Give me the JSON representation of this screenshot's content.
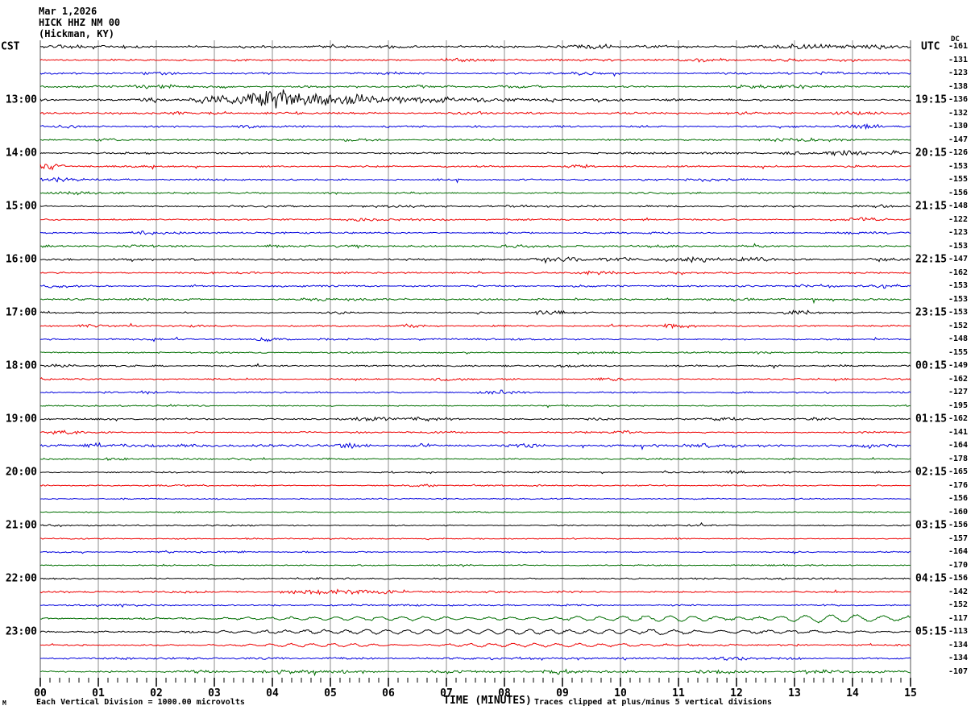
{
  "header": {
    "date": "Mar 1,2026",
    "station": "HICK HHZ NM 00",
    "location": "(Hickman, KY)"
  },
  "axes": {
    "left_label": "CST",
    "right_label": "UTC",
    "dc_header": "DC",
    "x_ticks": [
      "00",
      "01",
      "02",
      "03",
      "04",
      "05",
      "06",
      "07",
      "08",
      "09",
      "10",
      "11",
      "12",
      "13",
      "14",
      "15"
    ],
    "x_title": "TIME (MINUTES)"
  },
  "footer": {
    "scale_note": "Each Vertical Division = 1000.00 microvolts",
    "clip_note": "Traces clipped at plus/minus 5 vertical divisions",
    "corner_mark": "M"
  },
  "colors": {
    "trace_cycle": [
      "#000000",
      "#ee0000",
      "#0000dd",
      "#006e00"
    ],
    "grid": "#8c8c8c",
    "border": "#555555",
    "tick": "#000000"
  },
  "chart_data": {
    "type": "line",
    "kind": "seismogram-helicorder",
    "minutes_per_line": 15,
    "x_range_minutes": [
      0,
      15
    ],
    "note": "48 trace lines of 15 minutes each, colors cycle black/red/blue/green; cst = line start local time, utc = line end UTC time, dc = DC offset counts shown at right",
    "rows": [
      {
        "c": 0,
        "dc": -161,
        "amp": 1.2,
        "ev": [
          {
            "t": 0.6,
            "w": 0.5,
            "a": 2.2
          },
          {
            "t": 5.0,
            "w": 0.3,
            "a": 1.8
          },
          {
            "t": 9.6,
            "w": 0.4,
            "a": 2.6
          },
          {
            "t": 13.2,
            "w": 0.8,
            "a": 2.4
          },
          {
            "t": 14.6,
            "w": 0.3,
            "a": 2.2
          }
        ]
      },
      {
        "c": 1,
        "dc": -131,
        "amp": 1.0,
        "ev": [
          {
            "t": 7.2,
            "w": 0.3,
            "a": 1.8
          },
          {
            "t": 11.5,
            "w": 0.4,
            "a": 2.2
          },
          {
            "t": 12.8,
            "w": 0.3,
            "a": 2.0
          },
          {
            "t": 13.9,
            "w": 0.3,
            "a": 1.8
          }
        ]
      },
      {
        "c": 2,
        "dc": -123,
        "amp": 0.9,
        "ev": [
          {
            "t": 2.0,
            "w": 0.4,
            "a": 1.8
          },
          {
            "t": 6.0,
            "w": 0.3,
            "a": 1.5
          },
          {
            "t": 9.4,
            "w": 0.3,
            "a": 1.8
          },
          {
            "t": 13.6,
            "w": 0.4,
            "a": 1.6
          }
        ]
      },
      {
        "c": 3,
        "dc": -138,
        "amp": 1.0,
        "ev": [
          {
            "t": 2.1,
            "w": 0.5,
            "a": 2.2
          },
          {
            "t": 6.6,
            "w": 0.3,
            "a": 1.6
          },
          {
            "t": 12.9,
            "w": 1.0,
            "a": 1.8
          }
        ]
      },
      {
        "c": 0,
        "dc": -136,
        "cst": "13:00",
        "utc": "19:15",
        "amp": 1.1,
        "ev": [
          {
            "t": 2.0,
            "w": 0.25,
            "a": 3.0
          },
          {
            "t": 3.0,
            "w": 0.5,
            "a": 5.0
          },
          {
            "t": 4.0,
            "w": 0.55,
            "a": 13.0
          },
          {
            "t": 4.9,
            "w": 0.8,
            "a": 7.0
          },
          {
            "t": 6.2,
            "w": 1.2,
            "a": 3.5
          },
          {
            "t": 8.0,
            "w": 1.5,
            "a": 1.8
          }
        ]
      },
      {
        "c": 1,
        "dc": -132,
        "amp": 1.0,
        "ev": [
          {
            "t": 2.4,
            "w": 0.3,
            "a": 2.0
          },
          {
            "t": 7.6,
            "w": 0.3,
            "a": 1.6
          },
          {
            "t": 12.1,
            "w": 0.3,
            "a": 1.5
          },
          {
            "t": 14.1,
            "w": 0.4,
            "a": 2.2
          }
        ]
      },
      {
        "c": 2,
        "dc": -130,
        "amp": 0.9,
        "ev": [
          {
            "t": 0.5,
            "w": 0.3,
            "a": 1.8
          },
          {
            "t": 3.6,
            "w": 0.2,
            "a": 1.5
          },
          {
            "t": 14.2,
            "w": 0.4,
            "a": 2.4
          }
        ]
      },
      {
        "c": 3,
        "dc": -147,
        "amp": 0.9,
        "ev": [
          {
            "t": 1.1,
            "w": 0.3,
            "a": 1.6
          },
          {
            "t": 5.5,
            "w": 0.3,
            "a": 1.5
          },
          {
            "t": 13.1,
            "w": 0.6,
            "a": 2.0
          }
        ]
      },
      {
        "c": 0,
        "dc": -126,
        "cst": "14:00",
        "utc": "20:15",
        "amp": 0.9,
        "ev": [
          {
            "t": 13.0,
            "w": 0.25,
            "a": 2.2
          },
          {
            "t": 13.9,
            "w": 0.5,
            "a": 2.6
          },
          {
            "t": 14.7,
            "w": 0.3,
            "a": 2.0
          }
        ]
      },
      {
        "c": 1,
        "dc": -153,
        "amp": 0.9,
        "ev": [
          {
            "t": 0.15,
            "w": 0.25,
            "a": 4.0
          },
          {
            "t": 9.3,
            "w": 0.3,
            "a": 2.0
          }
        ]
      },
      {
        "c": 2,
        "dc": -155,
        "amp": 0.9,
        "ev": [
          {
            "t": 0.4,
            "w": 0.4,
            "a": 2.2
          },
          {
            "t": 11.3,
            "w": 0.3,
            "a": 1.6
          }
        ]
      },
      {
        "c": 3,
        "dc": -156,
        "amp": 0.9,
        "ev": [
          {
            "t": 0.6,
            "w": 0.5,
            "a": 2.0
          },
          {
            "t": 5.0,
            "w": 0.3,
            "a": 1.5
          }
        ]
      },
      {
        "c": 0,
        "dc": -148,
        "cst": "15:00",
        "utc": "21:15",
        "amp": 0.9,
        "ev": [
          {
            "t": 14.4,
            "w": 0.4,
            "a": 1.8
          }
        ]
      },
      {
        "c": 1,
        "dc": -122,
        "amp": 0.9,
        "ev": [
          {
            "t": 5.6,
            "w": 0.3,
            "a": 1.6
          },
          {
            "t": 14.2,
            "w": 0.4,
            "a": 2.6
          }
        ]
      },
      {
        "c": 2,
        "dc": -123,
        "amp": 0.9,
        "ev": [
          {
            "t": 1.9,
            "w": 0.4,
            "a": 2.0
          },
          {
            "t": 13.9,
            "w": 0.3,
            "a": 1.6
          }
        ]
      },
      {
        "c": 3,
        "dc": -153,
        "amp": 1.0,
        "ev": [
          {
            "t": 1.6,
            "w": 0.3,
            "a": 1.6
          },
          {
            "t": 5.2,
            "w": 0.3,
            "a": 1.6
          },
          {
            "t": 8.1,
            "w": 0.3,
            "a": 1.6
          }
        ]
      },
      {
        "c": 0,
        "dc": -147,
        "cst": "16:00",
        "utc": "22:15",
        "amp": 1.0,
        "ev": [
          {
            "t": 9.0,
            "w": 0.5,
            "a": 2.4
          },
          {
            "t": 10.0,
            "w": 0.4,
            "a": 2.2
          },
          {
            "t": 11.2,
            "w": 0.6,
            "a": 2.8
          },
          {
            "t": 12.3,
            "w": 0.4,
            "a": 2.2
          },
          {
            "t": 14.6,
            "w": 0.3,
            "a": 2.0
          }
        ]
      },
      {
        "c": 1,
        "dc": -162,
        "amp": 0.9,
        "ev": [
          {
            "t": 3.6,
            "w": 0.3,
            "a": 1.6
          },
          {
            "t": 9.6,
            "w": 0.4,
            "a": 2.0
          },
          {
            "t": 11.0,
            "w": 0.3,
            "a": 1.8
          }
        ]
      },
      {
        "c": 2,
        "dc": -153,
        "amp": 0.9,
        "ev": [
          {
            "t": 0.2,
            "w": 0.3,
            "a": 2.2
          },
          {
            "t": 4.1,
            "w": 0.3,
            "a": 1.6
          },
          {
            "t": 13.3,
            "w": 0.4,
            "a": 2.4
          },
          {
            "t": 14.6,
            "w": 0.3,
            "a": 2.0
          }
        ]
      },
      {
        "c": 3,
        "dc": -153,
        "amp": 0.9,
        "ev": [
          {
            "t": 4.9,
            "w": 0.4,
            "a": 2.0
          },
          {
            "t": 12.1,
            "w": 0.3,
            "a": 1.6
          }
        ]
      },
      {
        "c": 0,
        "dc": -153,
        "cst": "17:00",
        "utc": "23:15",
        "amp": 0.8,
        "ev": [
          {
            "t": 5.1,
            "w": 0.3,
            "a": 1.5
          },
          {
            "t": 8.8,
            "w": 0.3,
            "a": 3.0
          },
          {
            "t": 13.1,
            "w": 0.4,
            "a": 2.4
          }
        ]
      },
      {
        "c": 1,
        "dc": -152,
        "amp": 0.8,
        "ev": [
          {
            "t": 0.8,
            "w": 0.3,
            "a": 2.0
          },
          {
            "t": 6.3,
            "w": 0.3,
            "a": 1.6
          },
          {
            "t": 10.9,
            "w": 0.4,
            "a": 2.4
          }
        ]
      },
      {
        "c": 2,
        "dc": -148,
        "amp": 0.8,
        "ev": [
          {
            "t": 3.9,
            "w": 0.2,
            "a": 2.6
          }
        ]
      },
      {
        "c": 3,
        "dc": -155,
        "amp": 0.8,
        "ev": []
      },
      {
        "c": 0,
        "dc": -149,
        "cst": "18:00",
        "utc": "00:15",
        "amp": 0.8,
        "ev": [
          {
            "t": 0.3,
            "w": 0.3,
            "a": 2.0
          },
          {
            "t": 9.0,
            "w": 0.3,
            "a": 1.6
          }
        ]
      },
      {
        "c": 1,
        "dc": -162,
        "amp": 0.8,
        "ev": [
          {
            "t": 6.9,
            "w": 0.3,
            "a": 2.0
          },
          {
            "t": 9.9,
            "w": 0.3,
            "a": 1.8
          }
        ]
      },
      {
        "c": 2,
        "dc": -127,
        "amp": 0.8,
        "ev": [
          {
            "t": 1.9,
            "w": 0.3,
            "a": 1.6
          },
          {
            "t": 7.9,
            "w": 0.4,
            "a": 2.0
          }
        ]
      },
      {
        "c": 3,
        "dc": -195,
        "amp": 0.7,
        "ev": []
      },
      {
        "c": 0,
        "dc": -162,
        "cst": "19:00",
        "utc": "01:15",
        "amp": 0.9,
        "ev": [
          {
            "t": 5.8,
            "w": 0.5,
            "a": 2.4
          },
          {
            "t": 6.6,
            "w": 0.4,
            "a": 2.0
          },
          {
            "t": 11.8,
            "w": 0.3,
            "a": 1.8
          },
          {
            "t": 13.4,
            "w": 0.3,
            "a": 1.6
          }
        ]
      },
      {
        "c": 1,
        "dc": -141,
        "amp": 0.8,
        "ev": [
          {
            "t": 0.5,
            "w": 0.3,
            "a": 2.0
          },
          {
            "t": 10.1,
            "w": 0.3,
            "a": 1.6
          }
        ]
      },
      {
        "c": 2,
        "dc": -164,
        "amp": 1.2,
        "ev": [
          {
            "t": 0.9,
            "w": 0.3,
            "a": 2.2
          },
          {
            "t": 5.2,
            "w": 0.35,
            "a": 2.8
          },
          {
            "t": 6.6,
            "w": 0.3,
            "a": 2.0
          },
          {
            "t": 8.4,
            "w": 0.4,
            "a": 2.2
          },
          {
            "t": 11.4,
            "w": 0.4,
            "a": 2.2
          },
          {
            "t": 14.3,
            "w": 0.3,
            "a": 1.8
          }
        ]
      },
      {
        "c": 3,
        "dc": -178,
        "amp": 0.8,
        "ev": [
          {
            "t": 1.3,
            "w": 0.3,
            "a": 1.8
          }
        ]
      },
      {
        "c": 0,
        "dc": -165,
        "cst": "20:00",
        "utc": "02:15",
        "amp": 0.7,
        "ev": [
          {
            "t": 11.9,
            "w": 0.3,
            "a": 1.6
          }
        ]
      },
      {
        "c": 1,
        "dc": -176,
        "amp": 0.7,
        "ev": [
          {
            "t": 6.6,
            "w": 0.3,
            "a": 1.3
          }
        ]
      },
      {
        "c": 2,
        "dc": -156,
        "amp": 0.65,
        "ev": []
      },
      {
        "c": 3,
        "dc": -160,
        "amp": 0.65,
        "ev": []
      },
      {
        "c": 0,
        "dc": -156,
        "cst": "21:00",
        "utc": "03:15",
        "amp": 0.65,
        "ev": [
          {
            "t": 0.3,
            "w": 0.3,
            "a": 1.3
          }
        ]
      },
      {
        "c": 1,
        "dc": -157,
        "amp": 0.65,
        "ev": []
      },
      {
        "c": 2,
        "dc": -164,
        "amp": 0.7,
        "ev": [
          {
            "t": 2.1,
            "w": 0.3,
            "a": 1.3
          }
        ]
      },
      {
        "c": 3,
        "dc": -170,
        "amp": 0.65,
        "ev": []
      },
      {
        "c": 0,
        "dc": -156,
        "cst": "22:00",
        "utc": "04:15",
        "amp": 0.75,
        "ev": [
          {
            "t": 12.6,
            "w": 0.4,
            "a": 1.8
          }
        ]
      },
      {
        "c": 1,
        "dc": -142,
        "amp": 0.9,
        "ev": [
          {
            "t": 4.6,
            "w": 0.5,
            "a": 2.6
          },
          {
            "t": 5.3,
            "w": 0.5,
            "a": 2.8
          },
          {
            "t": 5.9,
            "w": 0.3,
            "a": 2.0
          }
        ]
      },
      {
        "c": 2,
        "dc": -152,
        "amp": 0.8,
        "ev": []
      },
      {
        "c": 3,
        "dc": -117,
        "amp": 0.8,
        "ev": [
          {
            "t": 6.0,
            "w": 3.0,
            "a": 2.0,
            "p": 0.38
          },
          {
            "t": 11.0,
            "w": 2.0,
            "a": 3.0,
            "p": 0.4
          },
          {
            "t": 13.8,
            "w": 1.5,
            "a": 3.8,
            "p": 0.45
          }
        ]
      },
      {
        "c": 0,
        "dc": -113,
        "cst": "23:00",
        "utc": "05:15",
        "amp": 0.9,
        "ev": [
          {
            "t": 5.5,
            "w": 2.5,
            "a": 2.2,
            "p": 0.35
          },
          {
            "t": 9.0,
            "w": 2.0,
            "a": 2.4,
            "p": 0.35
          },
          {
            "t": 12.0,
            "w": 2.5,
            "a": 1.8,
            "p": 0.4
          }
        ]
      },
      {
        "c": 1,
        "dc": -134,
        "amp": 0.9,
        "ev": [
          {
            "t": 5.0,
            "w": 2.0,
            "a": 1.6,
            "p": 0.35
          },
          {
            "t": 8.5,
            "w": 2.5,
            "a": 1.8,
            "p": 0.38
          }
        ]
      },
      {
        "c": 2,
        "dc": -134,
        "amp": 0.9,
        "ev": [
          {
            "t": 2.5,
            "w": 0.3,
            "a": 1.6
          },
          {
            "t": 8.2,
            "w": 0.4,
            "a": 1.8
          },
          {
            "t": 11.9,
            "w": 0.3,
            "a": 2.0
          },
          {
            "t": 13.0,
            "w": 0.3,
            "a": 1.8
          }
        ]
      },
      {
        "c": 3,
        "dc": -107,
        "amp": 1.0,
        "ev": [
          {
            "t": 2.7,
            "w": 0.4,
            "a": 1.8
          },
          {
            "t": 4.3,
            "w": 0.5,
            "a": 2.2
          },
          {
            "t": 5.2,
            "w": 0.3,
            "a": 2.0
          },
          {
            "t": 7.3,
            "w": 0.5,
            "a": 2.0
          },
          {
            "t": 9.0,
            "w": 0.4,
            "a": 2.2
          },
          {
            "t": 11.7,
            "w": 0.5,
            "a": 2.0
          },
          {
            "t": 13.3,
            "w": 0.4,
            "a": 1.8
          }
        ]
      }
    ]
  }
}
